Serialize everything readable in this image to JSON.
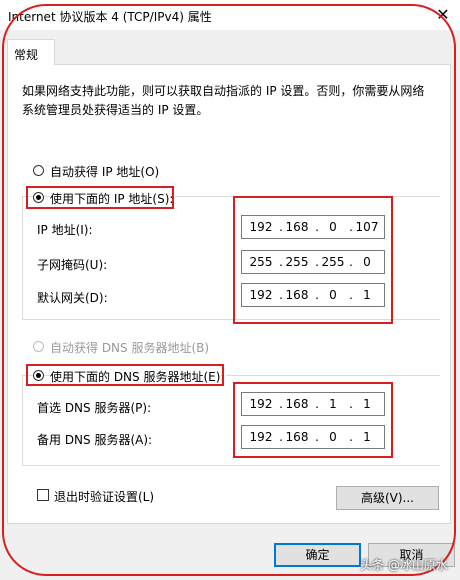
{
  "window": {
    "title": "Internet 协议版本 4 (TCP/IPv4) 属性",
    "close_glyph": "✕"
  },
  "tab": {
    "label": "常规"
  },
  "description": "如果网络支持此功能，则可以获取自动指派的 IP 设置。否则，你需要从网络系统管理员处获得适当的 IP 设置。",
  "ip_section": {
    "auto_label": "自动获得 IP 地址(O)",
    "manual_label": "使用下面的 IP 地址(S):",
    "selected": "manual",
    "fields": [
      {
        "label": "IP 地址(I):",
        "octets": [
          "192",
          "168",
          "0",
          "107"
        ]
      },
      {
        "label": "子网掩码(U):",
        "octets": [
          "255",
          "255",
          "255",
          "0"
        ]
      },
      {
        "label": "默认网关(D):",
        "octets": [
          "192",
          "168",
          "0",
          "1"
        ]
      }
    ]
  },
  "dns_section": {
    "auto_label": "自动获得 DNS 服务器地址(B)",
    "manual_label": "使用下面的 DNS 服务器地址(E):",
    "selected": "manual",
    "fields": [
      {
        "label": "首选 DNS 服务器(P):",
        "octets": [
          "192",
          "168",
          "1",
          "1"
        ]
      },
      {
        "label": "备用 DNS 服务器(A):",
        "octets": [
          "192",
          "168",
          "0",
          "1"
        ]
      }
    ]
  },
  "validate_on_exit": {
    "label": "退出时验证设置(L)",
    "checked": false
  },
  "buttons": {
    "advanced": "高级(V)...",
    "ok": "确定",
    "cancel": "取消"
  },
  "watermark": "头条 @冰山原水",
  "colors": {
    "annotation_red": "#d81e1e",
    "focus_blue": "#0078d7"
  }
}
